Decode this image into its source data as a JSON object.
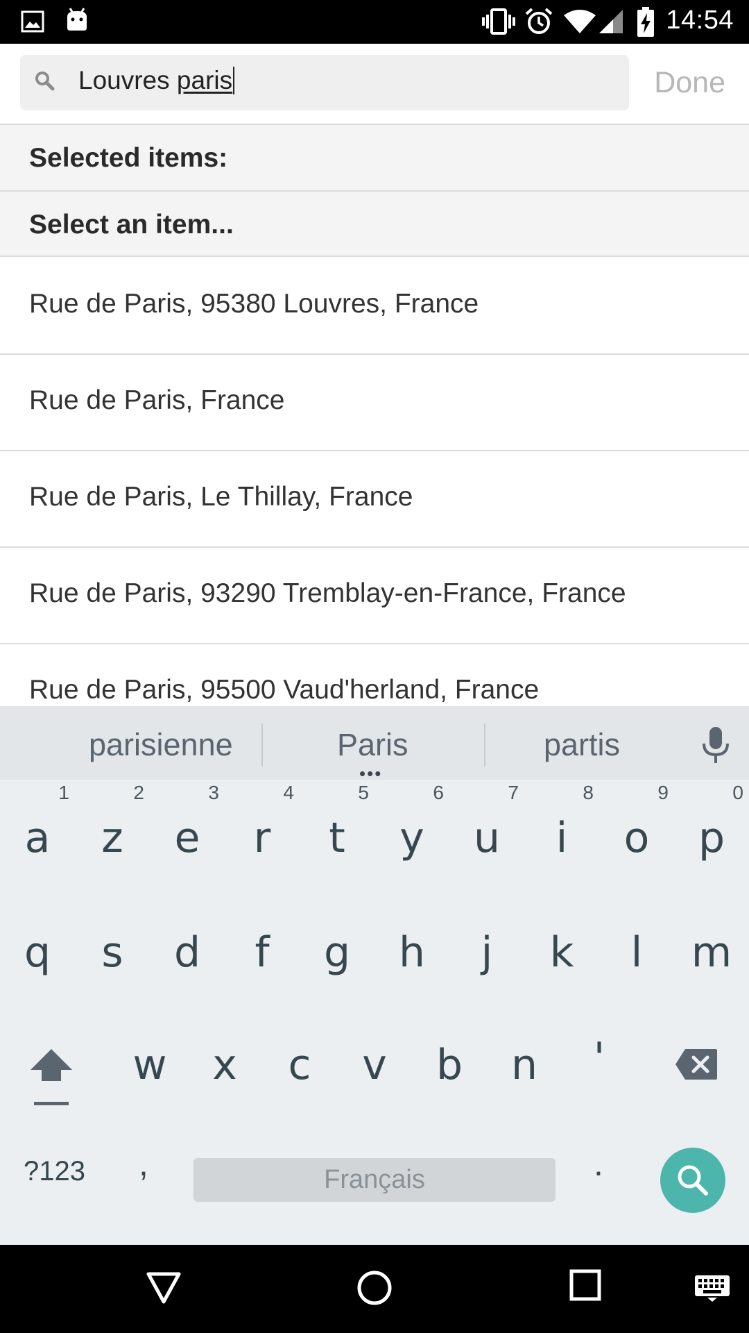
{
  "status_bar": {
    "time": "14:54",
    "icons": [
      "image-icon",
      "android-icon",
      "vibrate-icon",
      "alarm-icon",
      "wifi-icon",
      "signal-icon",
      "battery-charging-icon"
    ]
  },
  "search": {
    "query_prefix": "Louvres ",
    "query_underlined": "paris",
    "done_label": "Done"
  },
  "sections": {
    "selected_label": "Selected items:",
    "select_label": "Select an item..."
  },
  "results": [
    "Rue de Paris, 95380 Louvres, France",
    "Rue de Paris, France",
    "Rue de Paris, Le Thillay, France",
    "Rue de Paris, 93290 Tremblay-en-France, France",
    "Rue de Paris, 95500 Vaud'herland, France"
  ],
  "keyboard": {
    "suggestions": [
      "parisienne",
      "Paris",
      "partis"
    ],
    "more_indicator": "•••",
    "row1": [
      {
        "key": "a",
        "hint": "1"
      },
      {
        "key": "z",
        "hint": "2"
      },
      {
        "key": "e",
        "hint": "3"
      },
      {
        "key": "r",
        "hint": "4"
      },
      {
        "key": "t",
        "hint": "5"
      },
      {
        "key": "y",
        "hint": "6"
      },
      {
        "key": "u",
        "hint": "7"
      },
      {
        "key": "i",
        "hint": "8"
      },
      {
        "key": "o",
        "hint": "9"
      },
      {
        "key": "p",
        "hint": "0"
      }
    ],
    "row2": [
      "q",
      "s",
      "d",
      "f",
      "g",
      "h",
      "j",
      "k",
      "l",
      "m"
    ],
    "row3": [
      "w",
      "x",
      "c",
      "v",
      "b",
      "n",
      "'"
    ],
    "symbols_label": "?123",
    "comma": ",",
    "space_label": "Français",
    "period": ".",
    "accent_color": "#4db6ac"
  },
  "nav_bar": {
    "icons": [
      "back-icon",
      "home-icon",
      "recents-icon",
      "keyboard-switch-icon"
    ]
  }
}
